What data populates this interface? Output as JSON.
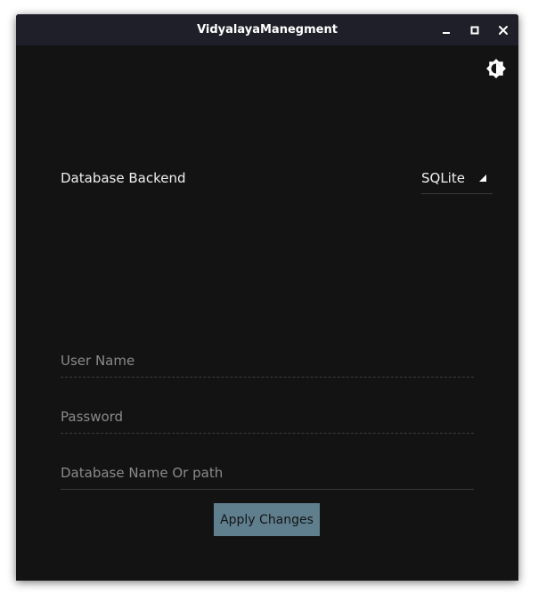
{
  "window": {
    "title": "VidyalayaManegment",
    "controls": {
      "minimize_icon": "minimize-icon",
      "maximize_icon": "maximize-icon",
      "close_icon": "close-icon"
    }
  },
  "toolbar": {
    "theme_toggle_icon": "brightness-icon"
  },
  "settings": {
    "database_backend_label": "Database Backend",
    "database_backend_value": "SQLite",
    "dropdown_icon": "triangle-down-icon"
  },
  "form": {
    "username": {
      "value": "",
      "placeholder": "User Name"
    },
    "password": {
      "value": "",
      "placeholder": "Password"
    },
    "database_name": {
      "value": "",
      "placeholder": "Database Name Or path"
    },
    "apply_label": "Apply Changes"
  },
  "colors": {
    "background": "#131313",
    "titlebar": "#1f1f29",
    "button": "#5f7f8e",
    "text": "#f0f0f0",
    "placeholder": "#8a8a8a"
  }
}
